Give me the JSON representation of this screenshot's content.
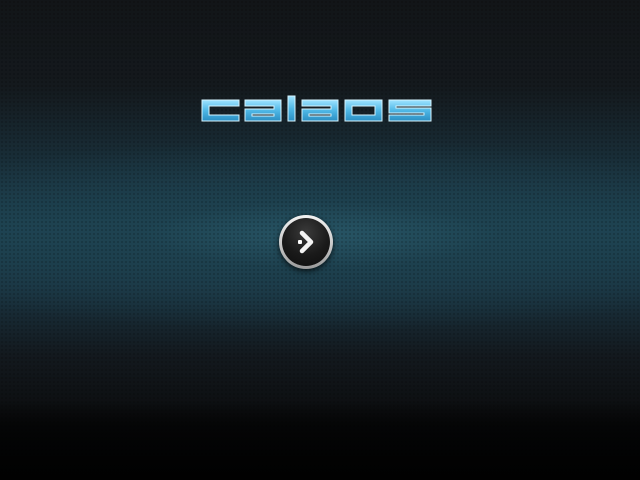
{
  "app": {
    "logo_text": "calaos"
  },
  "actions": {
    "next_icon": "chevron-right-icon"
  },
  "colors": {
    "logo_cyan": "#5ec8ef",
    "logo_outline": "#bfeeff",
    "accent_teal": "#1d4453"
  }
}
